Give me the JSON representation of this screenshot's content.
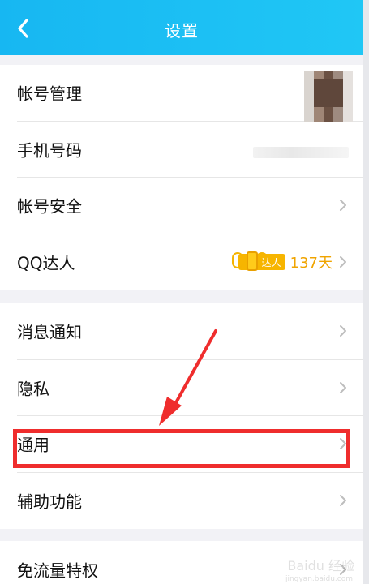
{
  "header": {
    "title": "设置"
  },
  "groups": [
    {
      "items": [
        {
          "label": "帐号管理"
        },
        {
          "label": "手机号码"
        },
        {
          "label": "帐号安全"
        },
        {
          "label": "QQ达人",
          "badge_text": "达人",
          "days": "137天"
        }
      ]
    },
    {
      "items": [
        {
          "label": "消息通知"
        },
        {
          "label": "隐私"
        },
        {
          "label": "通用"
        },
        {
          "label": "辅助功能"
        }
      ]
    },
    {
      "items": [
        {
          "label": "免流量特权"
        }
      ]
    }
  ],
  "colors": {
    "header_gradient_start": "#17b7f2",
    "header_gradient_end": "#20c7f5",
    "highlight_red": "#ef2d2d",
    "badge_gold": "#f7b500"
  },
  "icons": {
    "back": "chevron-left-icon",
    "chevron": "chevron-right-icon"
  },
  "watermark": {
    "main": "Baidu 经验",
    "sub": "jingyan.baidu.com"
  }
}
